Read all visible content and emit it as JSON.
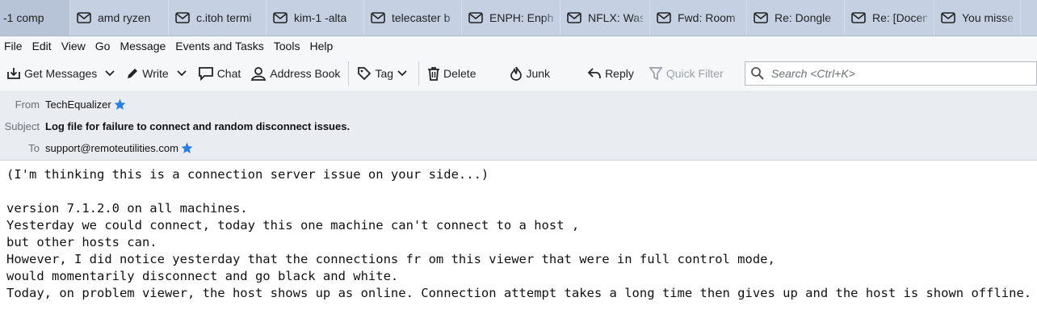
{
  "tabs": [
    {
      "label": "-1 comp",
      "icon": "mail-icon"
    },
    {
      "label": "amd ryzen",
      "icon": "mail-icon"
    },
    {
      "label": "c.itoh termi",
      "icon": "mail-icon"
    },
    {
      "label": "kim-1 -alta",
      "icon": "mail-icon"
    },
    {
      "label": "telecaster b",
      "icon": "mail-icon"
    },
    {
      "label": "ENPH: Enph",
      "icon": "mail-icon"
    },
    {
      "label": "NFLX: Was",
      "icon": "mail-icon"
    },
    {
      "label": "Fwd: Room",
      "icon": "mail-icon"
    },
    {
      "label": "Re: Dongle",
      "icon": "mail-icon"
    },
    {
      "label": "Re: [Docen",
      "icon": "mail-icon"
    },
    {
      "label": "You missed",
      "icon": "mail-icon"
    }
  ],
  "menu": [
    {
      "label": "File"
    },
    {
      "label": "Edit"
    },
    {
      "label": "View"
    },
    {
      "label": "Go"
    },
    {
      "label": "Message"
    },
    {
      "label": "Events and Tasks"
    },
    {
      "label": "Tools"
    },
    {
      "label": "Help"
    }
  ],
  "toolbar": {
    "get_messages": "Get Messages",
    "write": "Write",
    "chat": "Chat",
    "address_book": "Address Book",
    "tag": "Tag",
    "delete": "Delete",
    "junk": "Junk",
    "reply": "Reply",
    "quick_filter": "Quick Filter",
    "search_placeholder": "Search <Ctrl+K>"
  },
  "header": {
    "from_label": "From",
    "from_value": "TechEqualizer",
    "subject_label": "Subject",
    "subject_value": "Log file for failure to connect and random disconnect issues.",
    "to_label": "To",
    "to_value": "support@remoteutilities.com"
  },
  "body": [
    "(I'm thinking this is a connection server issue on your side...)",
    "",
    "version 7.1.2.0 on all machines.",
    "Yesterday we could connect, today this one machine can't connect to a host ,",
    "but other hosts can.",
    "However, I did notice yesterday that the connections fr om this viewer that were in full control mode,",
    "would momentarily disconnect and go black and white.",
    "Today, on problem viewer, the host shows up as online. Connection attempt takes a long time then gives up and the host is shown offline."
  ],
  "colors": {
    "accent": "#2a7de1",
    "tab_bg": "#c5d1e3",
    "header_bg": "#e9ecf1"
  }
}
